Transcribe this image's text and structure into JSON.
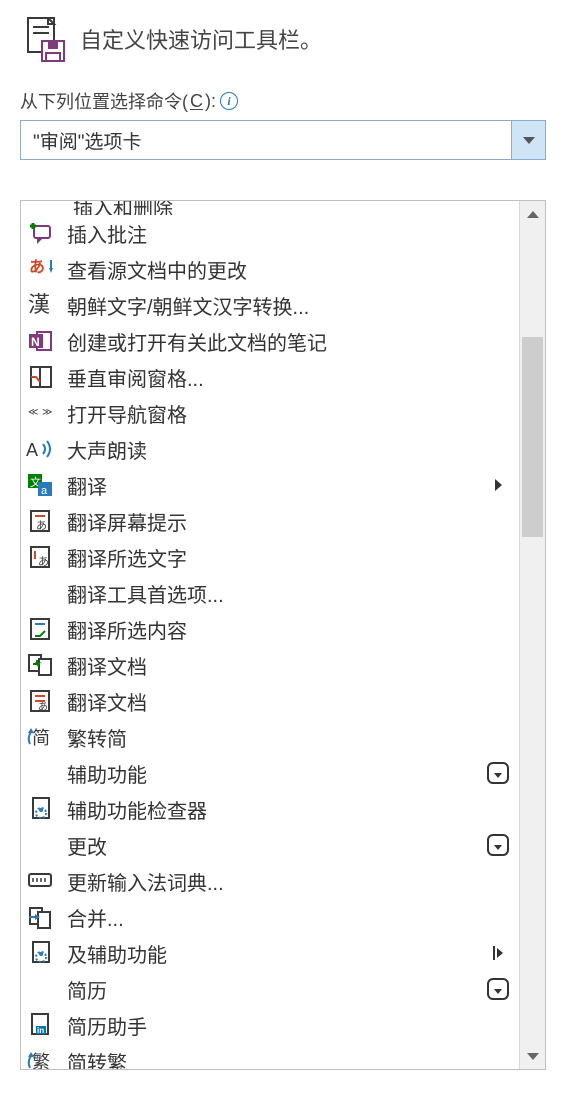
{
  "header": {
    "title": "自定义快速访问工具栏。"
  },
  "choose": {
    "prefix": "从下列位置选择命令(",
    "mnemonic": "C",
    "suffix": "):"
  },
  "dropdown": {
    "selected": "\"审阅\"选项卡"
  },
  "cutoff_text": "插入和删除",
  "commands": [
    {
      "icon": "insert-comment",
      "label": "插入批注",
      "trailing": null
    },
    {
      "icon": "view-source-changes",
      "label": "查看源文档中的更改",
      "trailing": null
    },
    {
      "icon": "hanja",
      "label": "朝鲜文字/朝鲜文汉字转换...",
      "trailing": null
    },
    {
      "icon": "onenote",
      "label": "创建或打开有关此文档的笔记",
      "trailing": null
    },
    {
      "icon": "vertical-review",
      "label": "垂直审阅窗格...",
      "trailing": null
    },
    {
      "icon": "nav-pane",
      "label": "打开导航窗格",
      "trailing": null
    },
    {
      "icon": "read-aloud",
      "label": "大声朗读",
      "trailing": null
    },
    {
      "icon": "translate",
      "label": "翻译",
      "trailing": "submenu"
    },
    {
      "icon": "translate-tips",
      "label": "翻译屏幕提示",
      "trailing": null
    },
    {
      "icon": "translate-selection-text",
      "label": "翻译所选文字",
      "trailing": null
    },
    {
      "icon": "none",
      "label": "翻译工具首选项...",
      "trailing": null
    },
    {
      "icon": "translate-selection",
      "label": "翻译所选内容",
      "trailing": null
    },
    {
      "icon": "translate-doc-arrow",
      "label": "翻译文档",
      "trailing": null
    },
    {
      "icon": "translate-doc",
      "label": "翻译文档",
      "trailing": null
    },
    {
      "icon": "trad-to-simp",
      "label": "繁转简",
      "trailing": null
    },
    {
      "icon": "none",
      "label": "辅助功能",
      "trailing": "dropdown-badge"
    },
    {
      "icon": "accessibility-check",
      "label": "辅助功能检查器",
      "trailing": null
    },
    {
      "icon": "none",
      "label": "更改",
      "trailing": "dropdown-badge"
    },
    {
      "icon": "ime-dict",
      "label": "更新输入法词典...",
      "trailing": null
    },
    {
      "icon": "combine",
      "label": "合并...",
      "trailing": null
    },
    {
      "icon": "accessibility-check",
      "label": "及辅助功能",
      "trailing": "sep-arrow"
    },
    {
      "icon": "none",
      "label": "简历",
      "trailing": "dropdown-badge"
    },
    {
      "icon": "resume-assistant",
      "label": "简历助手",
      "trailing": null
    },
    {
      "icon": "simp-to-trad",
      "label": "简转繁",
      "trailing": null
    }
  ]
}
